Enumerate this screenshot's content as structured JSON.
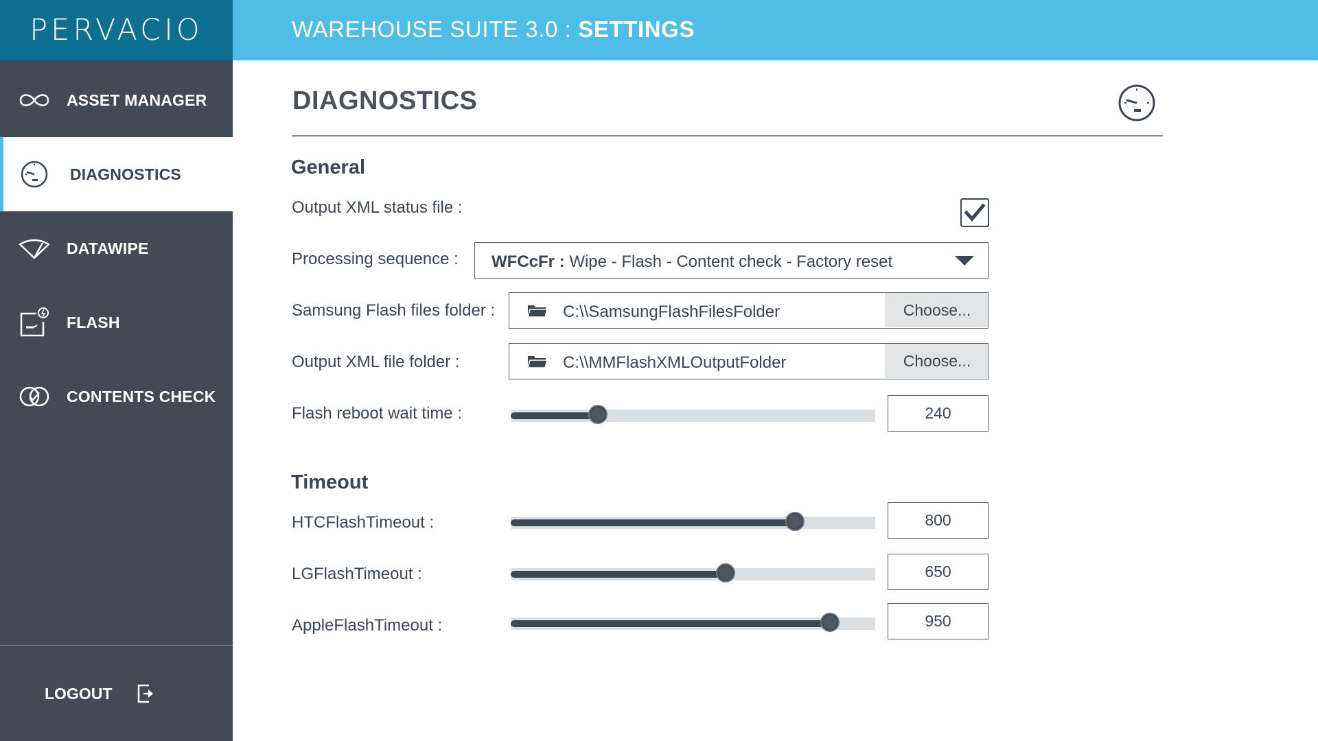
{
  "brand": {
    "logo": "PERVACIO"
  },
  "header": {
    "title_prefix": "WAREHOUSE SUITE 3.0 : ",
    "title_section": "SETTINGS"
  },
  "sidebar": {
    "items": [
      {
        "label": "ASSET MANAGER",
        "icon": "infinity-icon",
        "active": false
      },
      {
        "label": "DIAGNOSTICS",
        "icon": "gauge-icon",
        "active": true
      },
      {
        "label": "DATAWIPE",
        "icon": "wiper-icon",
        "active": false
      },
      {
        "label": "FLASH",
        "icon": "flash-icon",
        "active": false
      },
      {
        "label": "CONTENTS CHECK",
        "icon": "contents-check-icon",
        "active": false
      }
    ],
    "logout_label": "LOGOUT"
  },
  "main": {
    "title": "DIAGNOSTICS",
    "general": {
      "heading": "General",
      "output_xml_status": {
        "label": "Output XML status file :",
        "checked": true
      },
      "processing_sequence": {
        "label": "Processing sequence :",
        "code": "WFCcFr :",
        "value": " Wipe - Flash - Content check - Factory reset"
      },
      "samsung_folder": {
        "label": "Samsung Flash files folder :",
        "path": "C:\\\\SamsungFlashFilesFolder",
        "button": "Choose..."
      },
      "output_xml_folder": {
        "label": "Output XML file folder :",
        "path": "C:\\\\MMFlashXMLOutputFolder",
        "button": "Choose..."
      },
      "flash_reboot": {
        "label": "Flash reboot wait time :",
        "value": "240",
        "fraction": 0.24
      }
    },
    "timeout": {
      "heading": "Timeout",
      "htc": {
        "label": "HTCFlashTimeout :",
        "value": "800",
        "fraction": 0.78
      },
      "lg": {
        "label": "LGFlashTimeout :",
        "value": "650",
        "fraction": 0.59
      },
      "apple": {
        "label": "AppleFlashTimeout :",
        "value": "950",
        "fraction": 0.875
      }
    }
  },
  "colors": {
    "header": "#4fbee6",
    "logo_bg": "#0e6f91",
    "sidebar": "#434a53",
    "accent": "#4fbee6"
  }
}
